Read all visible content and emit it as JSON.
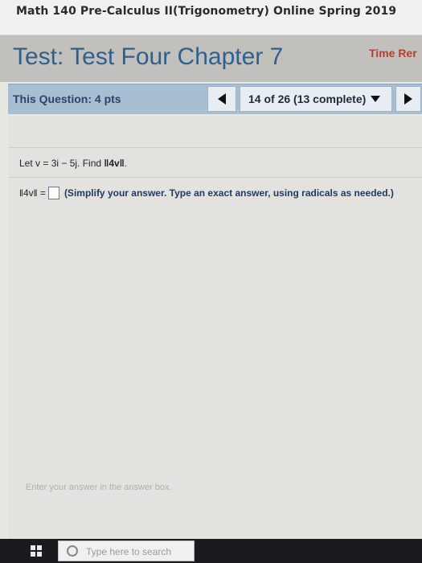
{
  "course": {
    "title": "Math 140 Pre-Calculus II(Trigonometry) Online Spring 2019"
  },
  "test": {
    "label": "Test:",
    "name": "Test Four Chapter 7",
    "time_remaining_label": "Time Rer"
  },
  "question_bar": {
    "points_label": "This Question: 4 pts",
    "position": "14 of 26 (13 complete)"
  },
  "problem": {
    "prompt_prefix": "Let v = 3i − 5j. Find",
    "norm_expr": "‖4v‖",
    "prompt_suffix": ".",
    "answer_lhs": "‖4v‖ =",
    "answer_value": "",
    "instruction": "(Simplify your answer. Type an exact answer, using radicals as needed.)"
  },
  "footer": {
    "hint": "Enter your answer in the answer box."
  },
  "taskbar": {
    "search_placeholder": "Type here to search"
  },
  "colors": {
    "title_blue": "#2e5f8e",
    "question_bar": "#a8bed2",
    "time_red": "#b04030"
  }
}
